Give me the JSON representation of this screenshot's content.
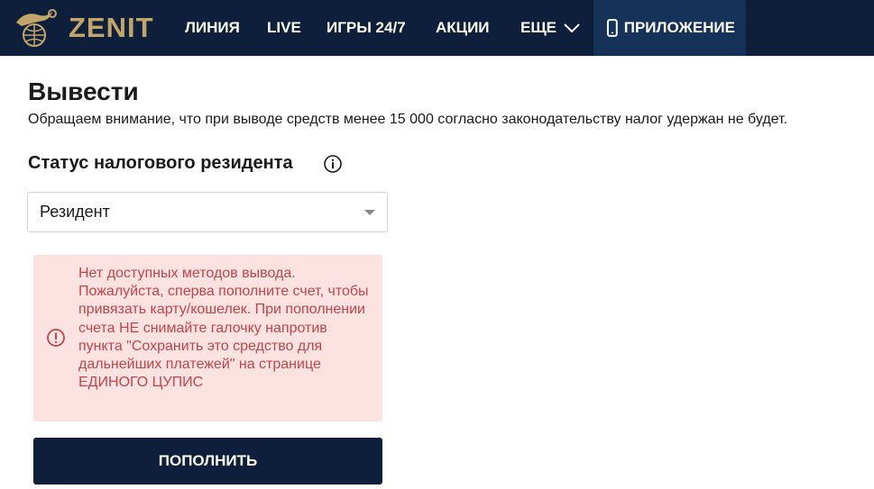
{
  "header": {
    "logo_text": "ZENIT",
    "nav": [
      {
        "label": "ЛИНИЯ"
      },
      {
        "label": "LIVE"
      },
      {
        "label": "ИГРЫ 24/7"
      },
      {
        "label": "АКЦИИ"
      },
      {
        "label": "ЕЩЕ",
        "icon": "chevron-down-icon"
      },
      {
        "label": "ПРИЛОЖЕНИЕ",
        "icon": "phone-icon"
      }
    ]
  },
  "page": {
    "title": "Вывести",
    "notice": "Обращаем внимание, что при выводе средств менее 15 000 согласно законодательству налог удержан не будет.",
    "tax_status": {
      "label": "Статус налогового резидента",
      "info_icon": "info-icon",
      "selected": "Резидент"
    },
    "alert": {
      "icon": "alert-icon",
      "text": "Нет доступных методов вывода. Пожалуйста, сперва пополните счет, чтобы привязать карту/кошелек. При пополнении счета НЕ снимайте галочку напротив пункта \"Сохранить это средство для дальнейших платежей\" на странице ЕДИНОГО ЦУПИС"
    },
    "deposit_button": "ПОПОЛНИТЬ"
  },
  "colors": {
    "header_bg": "#0e1f3c",
    "logo_gold": "#c2a56a",
    "app_tab_bg": "#163259",
    "alert_bg": "#fde2e2",
    "alert_text": "#c0464a",
    "button_bg": "#0e1f3c"
  }
}
